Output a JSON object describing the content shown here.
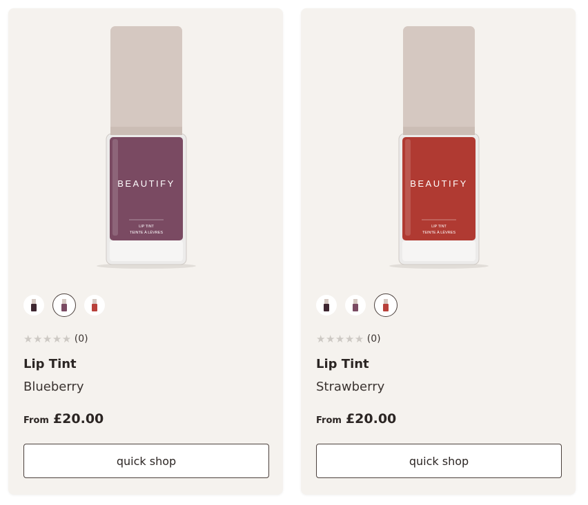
{
  "products": [
    {
      "brand": "BEAUTIFY",
      "bottle_text_1": "LIP TINT",
      "bottle_text_2": "TEINTE À LÈVRES",
      "bottle_color": "#7a4a62",
      "rating_stars": "★★★★★",
      "rating_count": "(0)",
      "name": "Lip Tint",
      "shade": "Blueberry",
      "price_prefix": "From",
      "price": "£20.00",
      "button_label": "quick shop",
      "swatches": [
        {
          "color": "#3e2630",
          "selected": false
        },
        {
          "color": "#7a4a62",
          "selected": true
        },
        {
          "color": "#b8403a",
          "selected": false
        }
      ]
    },
    {
      "brand": "BEAUTIFY",
      "bottle_text_1": "LIP TINT",
      "bottle_text_2": "TEINTE À LÈVRES",
      "bottle_color": "#b03a32",
      "rating_stars": "★★★★★",
      "rating_count": "(0)",
      "name": "Lip Tint",
      "shade": "Strawberry",
      "price_prefix": "From",
      "price": "£20.00",
      "button_label": "quick shop",
      "swatches": [
        {
          "color": "#3e2630",
          "selected": false
        },
        {
          "color": "#7a4a62",
          "selected": false
        },
        {
          "color": "#b8403a",
          "selected": true
        }
      ]
    }
  ]
}
